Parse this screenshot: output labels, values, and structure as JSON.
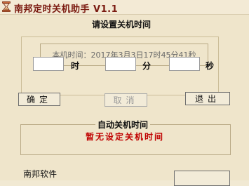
{
  "window": {
    "title": "南邦定时关机助手 V1.1",
    "icon": "hourglass-icon"
  },
  "schedule_group": {
    "title": "请设置关机时间",
    "current_time_text": "本机时间：2017年3月3日17时45分41秒"
  },
  "inputs": {
    "hour": {
      "value": "",
      "unit": "时"
    },
    "minute": {
      "value": "",
      "unit": "分"
    },
    "second": {
      "value": "",
      "unit": "秒"
    }
  },
  "buttons": {
    "confirm": "确定",
    "cancel": "取消",
    "exit": "退出"
  },
  "auto_shutdown": {
    "title": "自动关机时间",
    "status_text": "暂无设定关机时间"
  },
  "footer": {
    "text": "南邦软件"
  },
  "colors": {
    "title_red": "#7a1a10",
    "status_red": "#c00000",
    "background": "#efe5cb"
  }
}
